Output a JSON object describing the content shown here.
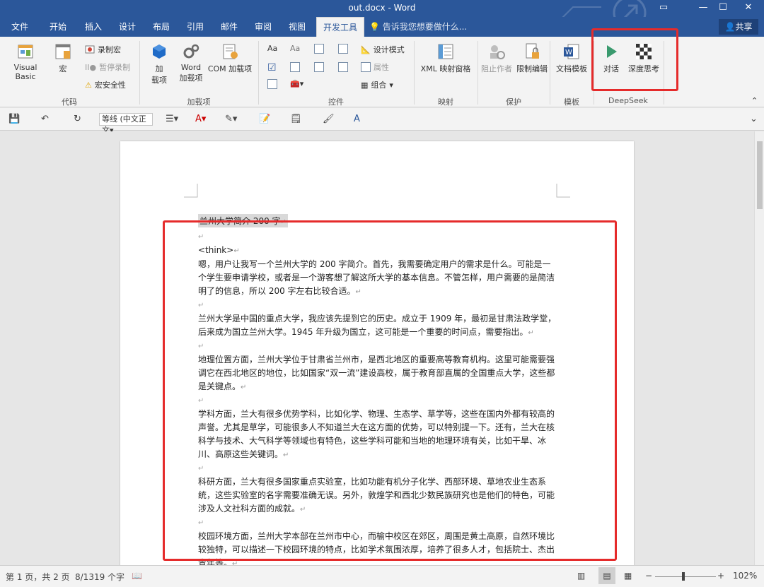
{
  "window": {
    "title": "out.docx - Word",
    "controls": {
      "restore": "▭",
      "minimize": "—",
      "maximize": "☐",
      "close": "✕"
    }
  },
  "tabs": [
    {
      "label": "文件"
    },
    {
      "label": "开始"
    },
    {
      "label": "插入"
    },
    {
      "label": "设计"
    },
    {
      "label": "布局"
    },
    {
      "label": "引用"
    },
    {
      "label": "邮件"
    },
    {
      "label": "审阅"
    },
    {
      "label": "视图"
    },
    {
      "label": "开发工具"
    }
  ],
  "tell_me": "告诉我您想要做什么...",
  "share": "共享",
  "ribbon": {
    "code": {
      "label": "代码",
      "visual_basic": "Visual Basic",
      "macro": "宏",
      "record_macro": "录制宏",
      "pause_record": "暂停录制",
      "macro_security": "宏安全性"
    },
    "addins": {
      "label": "加载项",
      "addins_l1": "加",
      "addins_l2": "载项",
      "word_l1": "Word",
      "word_l2": "加载项",
      "com": "COM 加载项"
    },
    "controls": {
      "label": "控件",
      "design_mode": "设计模式",
      "properties": "属性",
      "group": "组合"
    },
    "mapping": {
      "label": "映射",
      "xml_pane": "XML 映射窗格"
    },
    "protect": {
      "label": "保护",
      "block_authors": "阻止作者",
      "restrict_edit": "限制编辑"
    },
    "templates": {
      "label": "模板",
      "doc_template": "文档模板"
    },
    "deepseek": {
      "label": "DeepSeek",
      "dialog": "对话",
      "deep_think": "深度思考"
    }
  },
  "qat": {
    "font": "等线 (中文正文"
  },
  "document": {
    "title_line": "兰州大学简介 200 字",
    "think_tag": "<think>",
    "paragraphs": [
      "嗯，用户让我写一个兰州大学的 200 字简介。首先，我需要确定用户的需求是什么。可能是一个学生要申请学校，或者是一个游客想了解这所大学的基本信息。不管怎样，用户需要的是简洁明了的信息，所以 200 字左右比较合适。",
      "兰州大学是中国的重点大学，我应该先提到它的历史。成立于 1909 年，最初是甘肃法政学堂，后来成为国立兰州大学。1945 年升级为国立，这可能是一个重要的时间点，需要指出。",
      "地理位置方面，兰州大学位于甘肃省兰州市，是西北地区的重要高等教育机构。这里可能需要强调它在西北地区的地位，比如国家“双一流”建设高校，属于教育部直属的全国重点大学，这些都是关键点。",
      "学科方面，兰大有很多优势学科，比如化学、物理、生态学、草学等，这些在国内外都有较高的声誉。尤其是草学，可能很多人不知道兰大在这方面的优势，可以特别提一下。还有，兰大在核科学与技术、大气科学等领域也有特色，这些学科可能和当地的地理环境有关，比如干旱、冰川、高原这些关键词。",
      "科研方面，兰大有很多国家重点实验室，比如功能有机分子化学、西部环境、草地农业生态系统，这些实验室的名字需要准确无误。另外，敦煌学和西北少数民族研究也是他们的特色，可能涉及人文社科方面的成就。",
      "校园环境方面，兰州大学本部在兰州市中心，而榆中校区在郊区，周围是黄土高原，自然环境比较独特，可以描述一下校园环境的特点，比如学术氛围浓厚，培养了很多人才，包括院士、杰出青年等。"
    ]
  },
  "status": {
    "page": "第 1 页，共 2 页",
    "words": "8/1319 个字",
    "zoom": "102%"
  },
  "colors": {
    "accent": "#2b579a",
    "highlight": "#e52b2b"
  }
}
